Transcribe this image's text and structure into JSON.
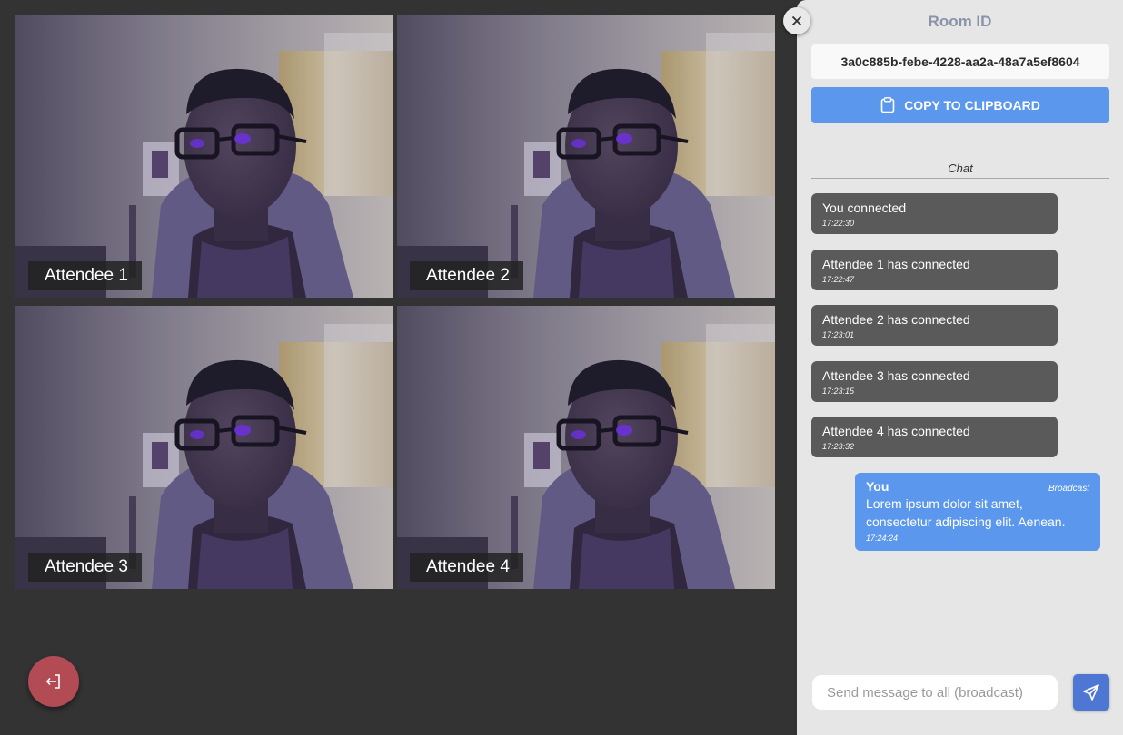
{
  "tiles": [
    {
      "label": "Attendee 1"
    },
    {
      "label": "Attendee 2"
    },
    {
      "label": "Attendee 3"
    },
    {
      "label": "Attendee 4"
    }
  ],
  "panel": {
    "room_title": "Room ID",
    "room_id": "3a0c885b-febe-4228-aa2a-48a7a5ef8604",
    "copy_label": "COPY TO CLIPBOARD",
    "chat_title": "Chat",
    "messages": [
      {
        "text": "You connected",
        "time": "17:22:30"
      },
      {
        "text": "Attendee 1 has connected",
        "time": "17:22:47"
      },
      {
        "text": "Attendee 2 has connected",
        "time": "17:23:01"
      },
      {
        "text": "Attendee 3 has connected",
        "time": "17:23:15"
      },
      {
        "text": "Attendee 4 has connected",
        "time": "17:23:32"
      }
    ],
    "own_message": {
      "sender": "You",
      "tag": "Broadcast",
      "text": "Lorem ipsum dolor sit amet, consectetur adipiscing elit. Aenean.",
      "time": "17:24:24"
    },
    "input_placeholder": "Send message to all (broadcast)"
  },
  "colors": {
    "background": "#333333",
    "panel": "#e6e6e6",
    "accent": "#5b97ec",
    "leave": "#b34b55",
    "send": "#4e76d3",
    "system_message": "#5a5a5a"
  },
  "icons": {
    "leave": "exit-icon",
    "close": "close-icon",
    "copy": "clipboard-icon",
    "send": "send-icon"
  }
}
